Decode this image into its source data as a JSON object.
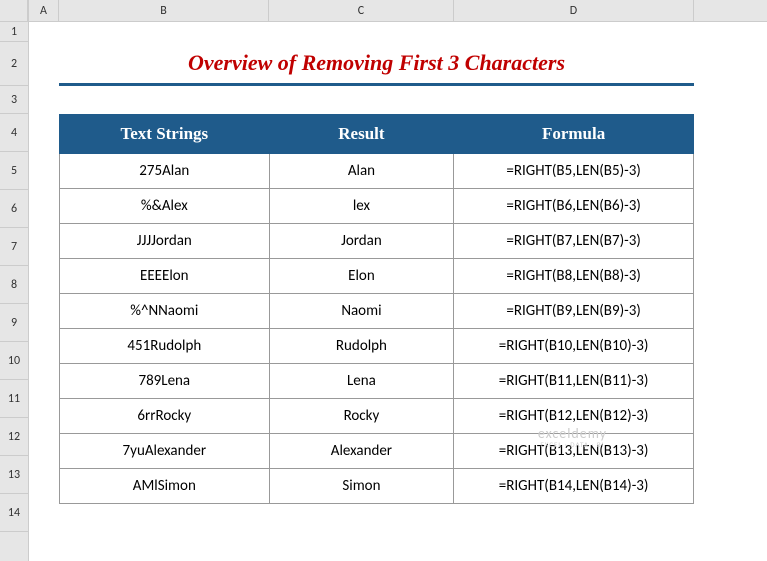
{
  "columns": {
    "a": "A",
    "b": "B",
    "c": "C",
    "d": "D"
  },
  "rows": [
    "1",
    "2",
    "3",
    "4",
    "5",
    "6",
    "7",
    "8",
    "9",
    "10",
    "11",
    "12",
    "13",
    "14"
  ],
  "title": "Overview of Removing First 3 Characters",
  "headers": {
    "col1": "Text Strings",
    "col2": "Result",
    "col3": "Formula"
  },
  "data": [
    {
      "text": "275Alan",
      "result": "Alan",
      "formula": "=RIGHT(B5,LEN(B5)-3)"
    },
    {
      "text": "%&Alex",
      "result": "lex",
      "formula": "=RIGHT(B6,LEN(B6)-3)"
    },
    {
      "text": "JJJJordan",
      "result": "Jordan",
      "formula": "=RIGHT(B7,LEN(B7)-3)"
    },
    {
      "text": "EEEElon",
      "result": "Elon",
      "formula": "=RIGHT(B8,LEN(B8)-3)"
    },
    {
      "text": "%^NNaomi",
      "result": "Naomi",
      "formula": "=RIGHT(B9,LEN(B9)-3)"
    },
    {
      "text": "451Rudolph",
      "result": "Rudolph",
      "formula": "=RIGHT(B10,LEN(B10)-3)"
    },
    {
      "text": "789Lena",
      "result": "Lena",
      "formula": "=RIGHT(B11,LEN(B11)-3)"
    },
    {
      "text": "6rrRocky",
      "result": "Rocky",
      "formula": "=RIGHT(B12,LEN(B12)-3)"
    },
    {
      "text": "7yuAlexander",
      "result": "Alexander",
      "formula": "=RIGHT(B13,LEN(B13)-3)"
    },
    {
      "text": "AMlSimon",
      "result": "Simon",
      "formula": "=RIGHT(B14,LEN(B14)-3)"
    }
  ],
  "watermark": {
    "brand": "exceldemy",
    "tagline": "EXCEL · DATA · BI"
  },
  "chart_data": {
    "type": "table",
    "title": "Overview of Removing First 3 Characters",
    "columns": [
      "Text Strings",
      "Result",
      "Formula"
    ],
    "rows": [
      [
        "275Alan",
        "Alan",
        "=RIGHT(B5,LEN(B5)-3)"
      ],
      [
        "%&Alex",
        "lex",
        "=RIGHT(B6,LEN(B6)-3)"
      ],
      [
        "JJJJordan",
        "Jordan",
        "=RIGHT(B7,LEN(B7)-3)"
      ],
      [
        "EEEElon",
        "Elon",
        "=RIGHT(B8,LEN(B8)-3)"
      ],
      [
        "%^NNaomi",
        "Naomi",
        "=RIGHT(B9,LEN(B9)-3)"
      ],
      [
        "451Rudolph",
        "Rudolph",
        "=RIGHT(B10,LEN(B10)-3)"
      ],
      [
        "789Lena",
        "Lena",
        "=RIGHT(B11,LEN(B11)-3)"
      ],
      [
        "6rrRocky",
        "Rocky",
        "=RIGHT(B12,LEN(B12)-3)"
      ],
      [
        "7yuAlexander",
        "Alexander",
        "=RIGHT(B13,LEN(B13)-3)"
      ],
      [
        "AMlSimon",
        "Simon",
        "=RIGHT(B14,LEN(B14)-3)"
      ]
    ]
  }
}
